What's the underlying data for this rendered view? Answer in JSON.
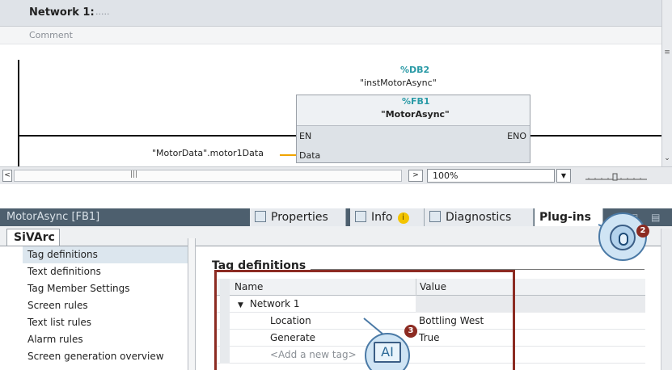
{
  "editor": {
    "network_title": "Network 1:",
    "network_dots": ".....",
    "comment": "Comment",
    "db_address": "%DB2",
    "db_name": "\"instMotorAsync\"",
    "fb_address": "%FB1",
    "fb_name": "\"MotorAsync\"",
    "pin_en": "EN",
    "pin_eno": "ENO",
    "pin_data": "Data",
    "data_param": "\"MotorData\".motor1Data",
    "zoom": "100%"
  },
  "inspector": {
    "title": "MotorAsync [FB1]",
    "tabs": {
      "properties": "Properties",
      "info": "Info",
      "info_badge": "i",
      "diagnostics": "Diagnostics",
      "plugins": "Plug-ins"
    },
    "sub_tab": "SiVArc",
    "nav_items": [
      "Tag definitions",
      "Text definitions",
      "Tag Member Settings",
      "Screen rules",
      "Text list rules",
      "Alarm rules",
      "Screen generation overview"
    ],
    "section_title": "Tag definitions",
    "table": {
      "col_name": "Name",
      "col_value": "Value",
      "group_arrow": "▼",
      "group_name": "Network 1",
      "rows": [
        {
          "name": "Location",
          "value": "Bottling West"
        },
        {
          "name": "Generate",
          "value": "True"
        }
      ],
      "add_placeholder": "<Add a new tag>"
    }
  },
  "callouts": {
    "badge_2": "2",
    "badge_3": "3",
    "ai_label": "AI"
  },
  "colors": {
    "accent_teal": "#2a9aa6",
    "frame_red": "#8c2b22",
    "inspector_bar": "#4d5f6e"
  }
}
